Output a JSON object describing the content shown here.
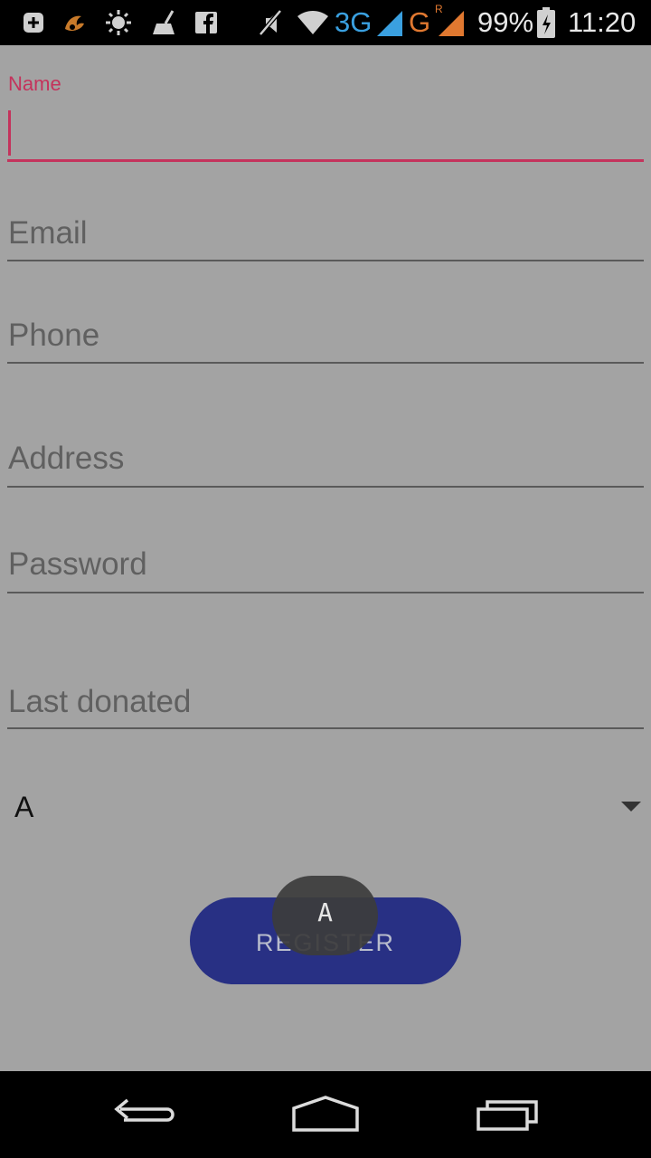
{
  "status_bar": {
    "icons": [
      "add-box-icon",
      "uc-browser-icon",
      "brightness-icon",
      "cleaner-icon",
      "facebook-icon",
      "mute-icon",
      "wifi-icon",
      "signal-3g-icon",
      "signal-g-roaming-icon",
      "battery-charging-icon"
    ],
    "net_3g": "3G",
    "net_g": "G",
    "roaming": "R",
    "battery": "99%",
    "time": "11:20"
  },
  "form": {
    "name_label": "Name",
    "name_value": "",
    "email_placeholder": "Email",
    "phone_placeholder": "Phone",
    "address_placeholder": "Address",
    "password_placeholder": "Password",
    "last_donated_placeholder": "Last donated",
    "blood_group_value": "A",
    "register_label": "REGISTER"
  },
  "toast": {
    "text": "A"
  },
  "nav_bar": {
    "buttons": [
      "back-icon",
      "home-icon",
      "recents-icon"
    ]
  },
  "colors": {
    "accent": "#c4335c",
    "button": "#283084",
    "background": "#a3a3a3"
  }
}
